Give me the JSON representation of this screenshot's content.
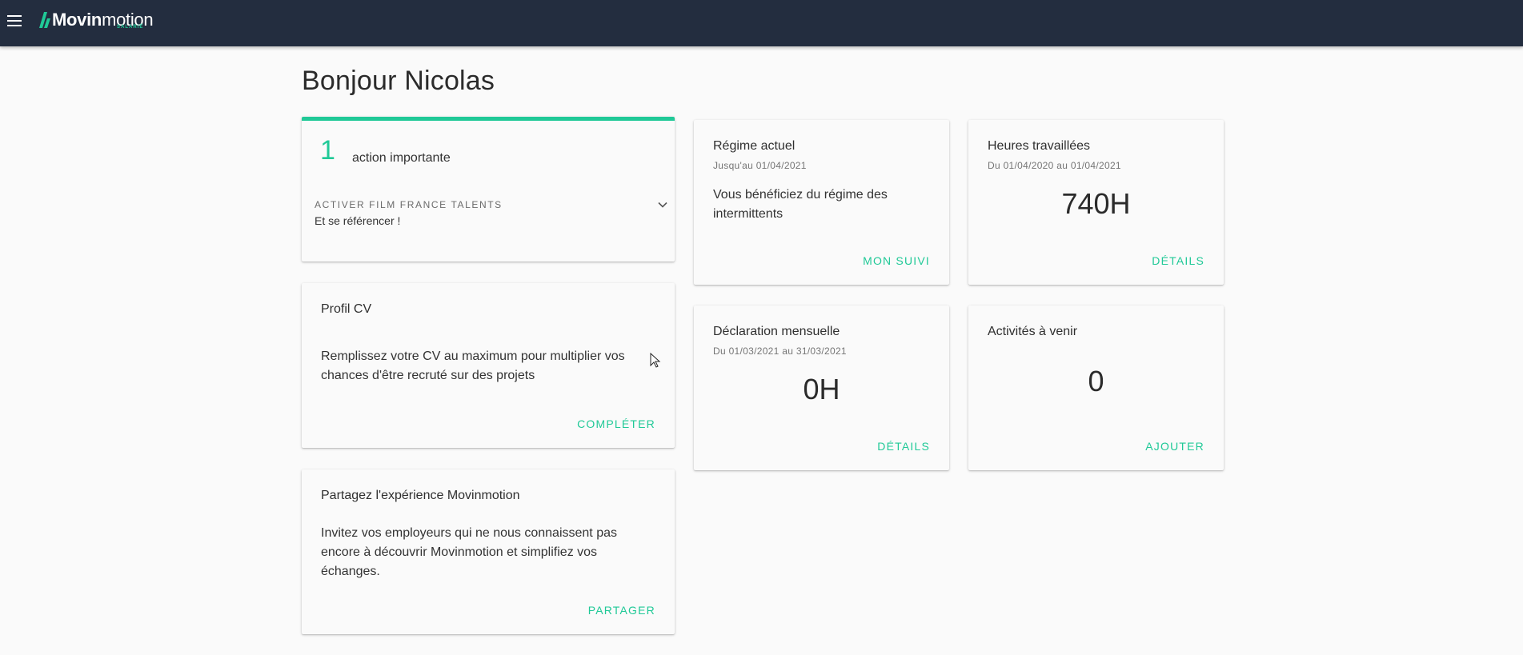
{
  "header": {
    "logo_bold": "Movin",
    "logo_light": "motion",
    "logo_sub": "SALARIÉ",
    "menu_icon": "hamburger-menu-icon",
    "brand_color": "#232d3f",
    "accent_color": "#20c997"
  },
  "greeting": "Bonjour Nicolas",
  "actions_card": {
    "count": "1",
    "label": "action importante",
    "item_title": "ACTIVER FILM FRANCE TALENTS",
    "item_sub": "Et se référencer !",
    "expand_icon": "chevron-down-icon"
  },
  "profile_card": {
    "title": "Profil CV",
    "body": "Remplissez votre CV au maximum pour multiplier vos chances d'être recruté sur des projets",
    "action": "COMPLÉTER"
  },
  "share_card": {
    "title": "Partagez l'expérience Movinmotion",
    "body": "Invitez vos employeurs qui ne nous connaissent pas encore à découvrir Movinmotion et simplifiez vos échanges.",
    "action": "PARTAGER"
  },
  "regime_card": {
    "title": "Régime actuel",
    "sub": "Jusqu'au 01/04/2021",
    "body": "Vous bénéficiez du régime des intermittents",
    "action": "MON SUIVI"
  },
  "hours_card": {
    "title": "Heures travaillées",
    "sub": "Du 01/04/2020 au 01/04/2021",
    "value": "740H",
    "action": "DÉTAILS"
  },
  "declaration_card": {
    "title": "Déclaration mensuelle",
    "sub": "Du 01/03/2021 au 31/03/2021",
    "value": "0H",
    "action": "DÉTAILS"
  },
  "activities_card": {
    "title": "Activités à venir",
    "value": "0",
    "action": "AJOUTER"
  }
}
